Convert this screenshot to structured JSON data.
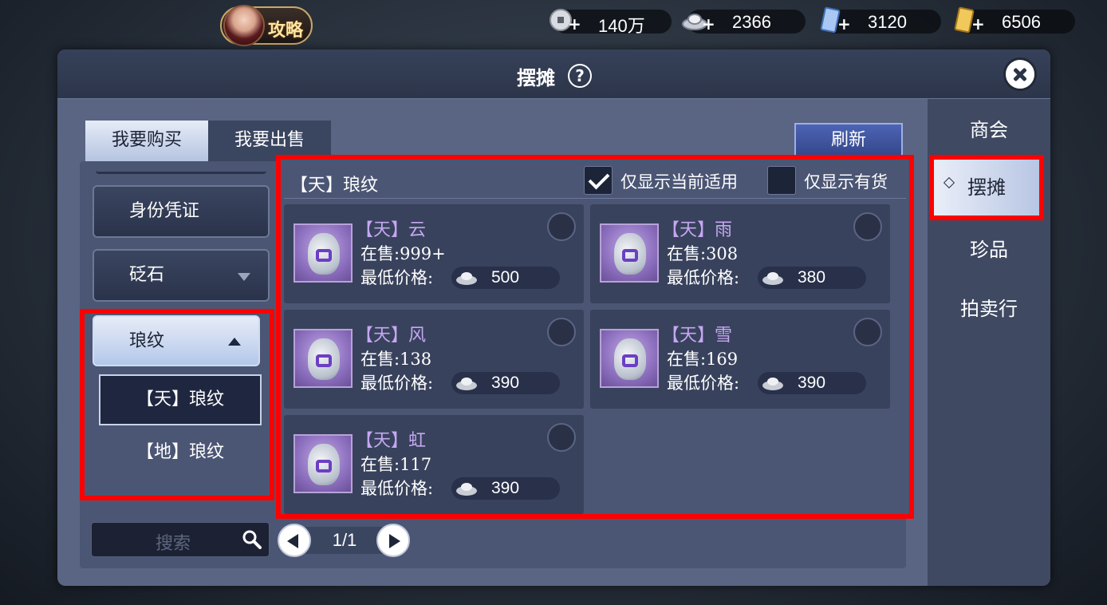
{
  "top_bar": {
    "guide_label": "攻略",
    "currencies": [
      {
        "icon": "copper-coin-icon",
        "value": "140万"
      },
      {
        "icon": "silver-ingot-icon",
        "value": "2366"
      },
      {
        "icon": "blue-ticket-icon",
        "value": "3120"
      },
      {
        "icon": "gold-ticket-icon",
        "value": "6506"
      }
    ]
  },
  "panel": {
    "title": "摆摊",
    "help": "?"
  },
  "tabs": {
    "buy": "我要购买",
    "sell": "我要出售"
  },
  "refresh_label": "刷新",
  "side_nav": [
    "商会",
    "摆摊",
    "珍品",
    "拍卖行"
  ],
  "categories": {
    "identity": "身份凭证",
    "stone": "砭石",
    "pattern": "琅纹",
    "sub": [
      "【天】琅纹",
      "【地】琅纹"
    ]
  },
  "grid": {
    "title": "【天】琅纹",
    "filter_applicable": "仅显示当前适用",
    "filter_in_stock": "仅显示有货",
    "price_label": "最低价格:",
    "items": [
      {
        "name": "【天】云",
        "stock": "在售:999+",
        "price": "500"
      },
      {
        "name": "【天】雨",
        "stock": "在售:308",
        "price": "380"
      },
      {
        "name": "【天】风",
        "stock": "在售:138",
        "price": "390"
      },
      {
        "name": "【天】雪",
        "stock": "在售:169",
        "price": "390"
      },
      {
        "name": "【天】虹",
        "stock": "在售:117",
        "price": "390"
      }
    ]
  },
  "search": {
    "placeholder": "搜索"
  },
  "pager": {
    "text": "1/1"
  },
  "colors": {
    "highlight_border": "#ff0000",
    "item_name": "#c6a7f2"
  }
}
